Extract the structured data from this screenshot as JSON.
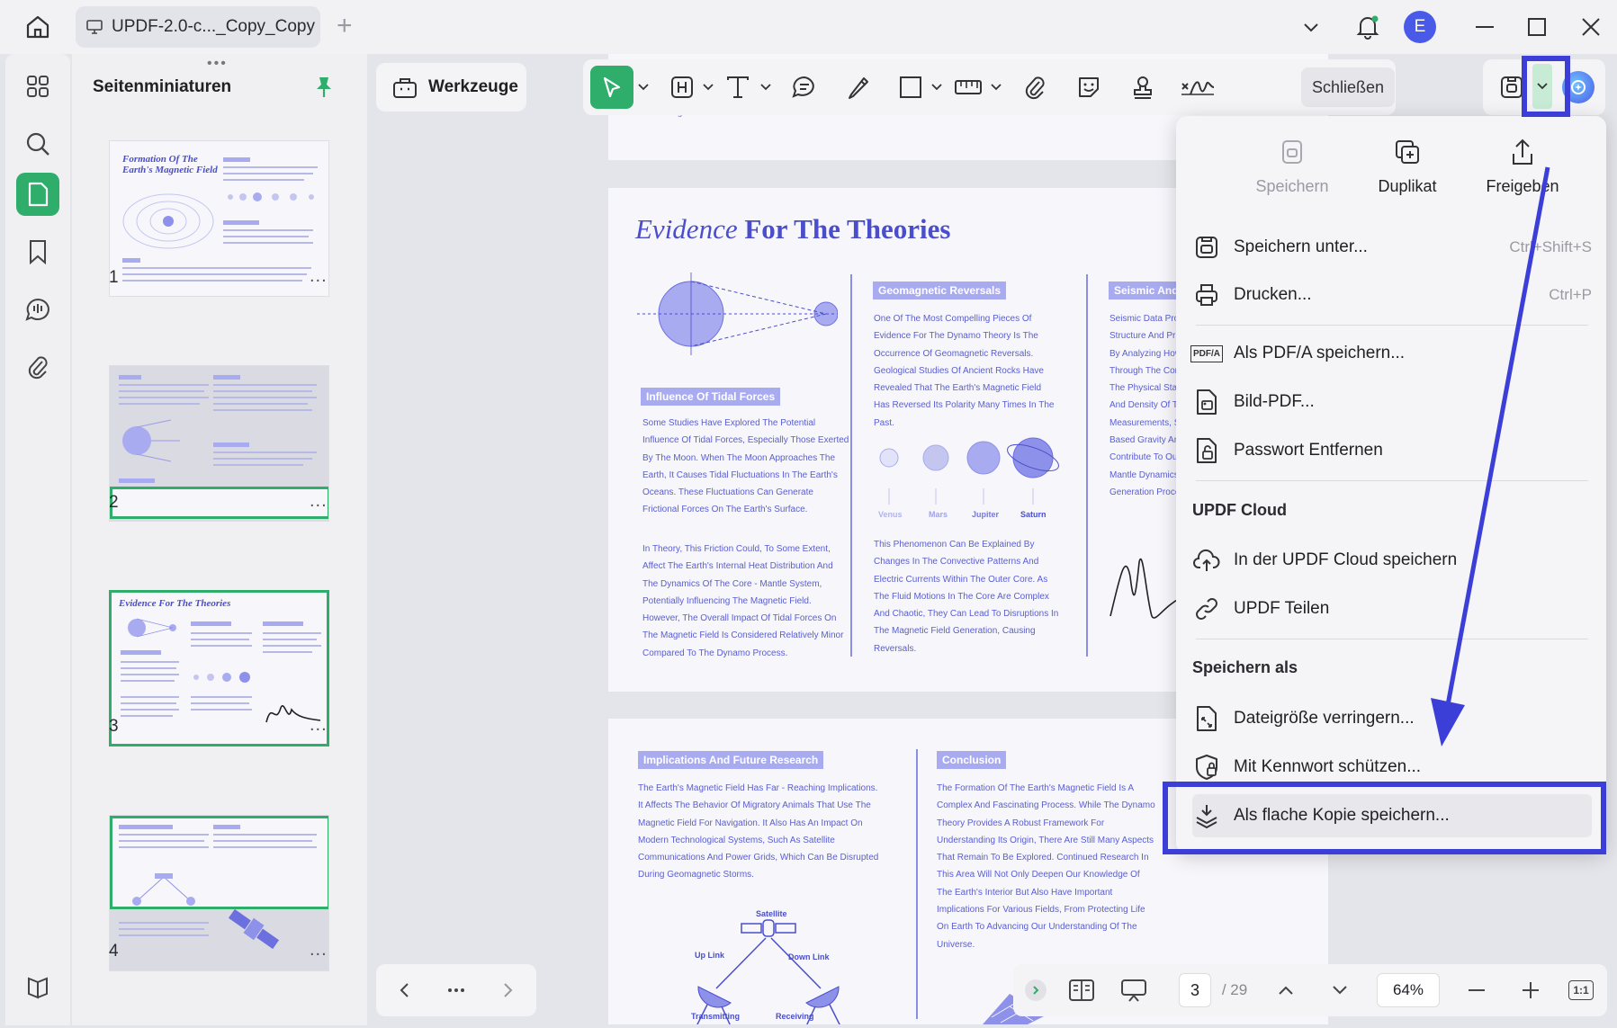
{
  "titlebar": {
    "tab_title": "UPDF-2.0-c..._Copy_Copy",
    "avatar_initial": "E"
  },
  "thumbnails": {
    "title": "Seitenminiaturen",
    "pages": [
      {
        "number": "1",
        "heading": "Formation Of The Earth's Magnetic Field"
      },
      {
        "number": "2"
      },
      {
        "number": "3",
        "heading": "Evidence For The Theories"
      },
      {
        "number": "4"
      }
    ],
    "more": "..."
  },
  "toolbar": {
    "tools_label": "Werkzeuge",
    "close_label": "Schließen"
  },
  "document": {
    "page_top_fragment": "Field's Origin Has Evolved.",
    "page3": {
      "heading_italic": "Evidence",
      "heading_rest": " For The Theories",
      "tag_tidal": "Influence Of Tidal Forces",
      "tidal_p1": "Some Studies Have Explored The Potential Influence Of Tidal Forces, Especially Those Exerted By The Moon. When The Moon Approaches The Earth, It Causes Tidal Fluctuations In The Earth's Oceans. These Fluctuations Can Generate Frictional Forces On The Earth's Surface.",
      "tidal_p2": "In Theory, This Friction Could, To Some Extent, Affect The Earth's Internal Heat Distribution And The Dynamics Of The Core - Mantle System, Potentially Influencing The Magnetic Field. However, The Overall Impact Of Tidal Forces On The Magnetic Field Is Considered Relatively Minor Compared To The Dynamo Process.",
      "tag_geo": "Geomagnetic Reversals",
      "geo_p1": "One Of The Most Compelling Pieces Of Evidence For The Dynamo Theory Is The Occurrence Of Geomagnetic Reversals. Geological Studies Of Ancient Rocks Have Revealed That The Earth's Magnetic Field Has Reversed Its Polarity Many Times In The Past.",
      "planets": [
        "Venus",
        "Mars",
        "Jupiter",
        "Saturn"
      ],
      "geo_p2": "This Phenomenon Can Be Explained By Changes In The Convective Patterns And Electric Currents Within The Outer Core. As The Fluid Motions In The Core Are Complex And Chaotic, They Can Lead To Disruptions In The Magnetic Field Generation, Causing Reversals.",
      "tag_seismic": "Seismic And",
      "seismic_lines": [
        "Seismic Data Prov",
        "Structure And Pr",
        "By Analyzing How",
        "Through The Core",
        "The Physical Stat",
        "And Density Of Th",
        "Measurements, S",
        "Based Gravity An",
        "Contribute To Ou",
        "Mantle Dynamics",
        "Generation Proce"
      ]
    },
    "page4": {
      "tag_impl": "Implications And Future Research",
      "impl_p": "The Earth's Magnetic Field Has Far - Reaching Implications. It Affects The Behavior Of Migratory Animals That Use The Magnetic Field For Navigation. It Also Has An Impact On Modern Technological Systems, Such As Satellite Communications And Power Grids, Which Can Be Disrupted During Geomagnetic Storms.",
      "sat_labels": {
        "satellite": "Satellite",
        "uplink": "Up Link",
        "downlink": "Down Link",
        "transmitting": "Transmitting",
        "receiving": "Receiving"
      },
      "tag_concl": "Conclusion",
      "concl_p": "The Formation Of The Earth's Magnetic Field Is A Complex And Fascinating Process. While The Dynamo Theory Provides A Robust Framework For Understanding Its Origin, There Are Still Many Aspects That Remain To Be Explored. Continued Research In This Area Will Not Only Deepen Our Knowledge Of The Earth's Interior But Also Have Important Implications For Various Fields, From Protecting Life On Earth To Advancing Our Understanding Of The Universe."
    }
  },
  "menu": {
    "quick_actions": [
      {
        "label": "Speichern",
        "icon": "save-icon",
        "disabled": true
      },
      {
        "label": "Duplikat",
        "icon": "duplicate-icon"
      },
      {
        "label": "Freigeben",
        "icon": "share-icon"
      }
    ],
    "items": {
      "save_as": {
        "label": "Speichern unter...",
        "shortcut": "Ctrl+Shift+S"
      },
      "print": {
        "label": "Drucken...",
        "shortcut": "Ctrl+P"
      },
      "pdfa": {
        "label": "Als PDF/A speichern..."
      },
      "image_pdf": {
        "label": "Bild-PDF..."
      },
      "remove_password": {
        "label": "Passwort Entfernen"
      },
      "cloud_save": {
        "label": "In der UPDF Cloud speichern"
      },
      "updf_share": {
        "label": "UPDF Teilen"
      },
      "reduce_size": {
        "label": "Dateigröße verringern..."
      },
      "protect": {
        "label": "Mit Kennwort schützen..."
      },
      "flatten": {
        "label": "Als flache Kopie speichern..."
      }
    },
    "section_cloud": "UPDF Cloud",
    "section_save_as": "Speichern als",
    "pdfa_badge": "PDF/A"
  },
  "viewbar": {
    "current_page": "3",
    "total_pages": "/ 29",
    "zoom": "64%",
    "fit_label": "1:1"
  },
  "colors": {
    "accent_green": "#2eae6a",
    "highlight_blue": "#3b3fd8",
    "doc_purple": "#4a4ecb"
  }
}
